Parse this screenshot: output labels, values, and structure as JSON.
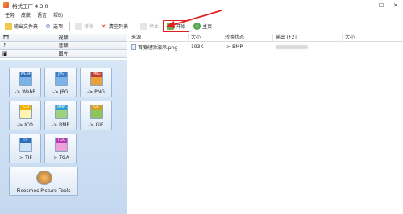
{
  "window": {
    "title": "格式工厂 4.3.0",
    "ctrl_min": "—",
    "ctrl_max": "☐",
    "ctrl_close": "✕"
  },
  "menu": {
    "items": [
      "任务",
      "皮肤",
      "语言",
      "帮助"
    ]
  },
  "toolbar": {
    "output_folder": "输出文件夹",
    "options": "选项",
    "remove": "移除",
    "clear_list": "清空列表",
    "stop": "停止",
    "start": "开始",
    "home": "主页"
  },
  "sidebar": {
    "categories": [
      "视频",
      "音频",
      "图片"
    ],
    "tiles": [
      {
        "label": "-> WebP",
        "band": "#2a6fb8",
        "tag": "WEBP"
      },
      {
        "label": "-> JPG",
        "band": "#3a7fc8",
        "tag": "JPG"
      },
      {
        "label": "-> PNG",
        "band": "#c43c2c",
        "tag": "PNG"
      },
      {
        "label": "-> ICO",
        "band": "#f0b400",
        "tag": "ICO"
      },
      {
        "label": "-> BMP",
        "band": "#2a9fd8",
        "tag": "BMP"
      },
      {
        "label": "-> GIF",
        "band": "#d4a020",
        "tag": "GIF"
      },
      {
        "label": "-> TIF",
        "band": "#2a6fb8",
        "tag": "TIF"
      },
      {
        "label": "-> TGA",
        "band": "#b83ab0",
        "tag": "TGA"
      }
    ],
    "picosmos": "Picosmos Picture Tools"
  },
  "filelist": {
    "columns": [
      "来源",
      "大小",
      "转换状态",
      "输出 [F2]",
      "大小"
    ],
    "rows": [
      {
        "source": "百度经验演示.png",
        "size": "193K",
        "status": "-> BMP"
      }
    ]
  }
}
